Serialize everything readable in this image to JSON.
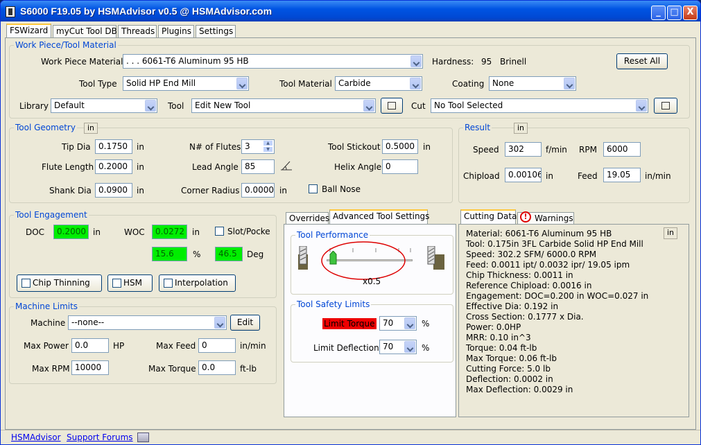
{
  "window": {
    "title": "S6000 F19.05 by HSMAdvisor v0.5 @ HSMAdvisor.com",
    "minimize": "_",
    "maximize": "□",
    "close": "X"
  },
  "tabs": [
    "FSWizard",
    "myCut Tool DB",
    "Threads",
    "Plugins",
    "Settings"
  ],
  "workpiece": {
    "title": "Work Piece/Tool Material",
    "material_label": "Work Piece Material",
    "material_value": ". . . 6061-T6 Aluminum 95 HB",
    "hardness_label": "Hardness:",
    "hardness_value": "95",
    "hardness_unit": "Brinell",
    "reset_label": "Reset All",
    "tooltype_label": "Tool Type",
    "tooltype_value": "Solid HP End Mill",
    "toolmat_label": "Tool Material",
    "toolmat_value": "Carbide",
    "coating_label": "Coating",
    "coating_value": "None",
    "library_label": "Library",
    "library_value": "Default",
    "tool_label": "Tool",
    "tool_value": "Edit New Tool",
    "cut_label": "Cut",
    "cut_value": "No Tool Selected"
  },
  "geometry": {
    "title": "Tool Geometry",
    "unit": "in",
    "tipdia_label": "Tip Dia",
    "tipdia": "0.1750",
    "flutelen_label": "Flute Length",
    "flutelen": "0.2000",
    "shankdia_label": "Shank Dia",
    "shankdia": "0.0900",
    "u": "in",
    "flutes_label": "N# of Flutes",
    "flutes": "3",
    "lead_label": "Lead Angle",
    "lead": "85",
    "corner_label": "Corner Radius",
    "corner": "0.0000",
    "stickout_label": "Tool Stickout",
    "stickout": "0.5000",
    "helix_label": "Helix Angle",
    "helix": "0",
    "ballnose_label": "Ball Nose"
  },
  "result": {
    "title": "Result",
    "unit": "in",
    "speed_label": "Speed",
    "speed": "302",
    "speed_unit": "f/min",
    "rpm_label": "RPM",
    "rpm": "6000",
    "chipload_label": "Chipload",
    "chipload": "0.00106",
    "chipload_unit": "in",
    "feed_label": "Feed",
    "feed": "19.05",
    "feed_unit": "in/min"
  },
  "engagement": {
    "title": "Tool Engagement",
    "doc_label": "DOC",
    "doc": "0.2000",
    "doc_unit": "in",
    "woc_label": "WOC",
    "woc": "0.0272",
    "woc_unit": "in",
    "slot_label": "Slot/Pocke",
    "pct": "15.6",
    "pct_unit": "%",
    "deg": "46.5",
    "deg_unit": "Deg",
    "chip_thinning": "Chip Thinning",
    "hsm": "HSM",
    "interpolation": "Interpolation"
  },
  "machine": {
    "title": "Machine Limits",
    "machine_label": "Machine",
    "machine_value": "--none--",
    "edit_label": "Edit",
    "maxpower_label": "Max Power",
    "maxpower": "0.0",
    "maxpower_unit": "HP",
    "maxfeed_label": "Max Feed",
    "maxfeed": "0",
    "maxfeed_unit": "in/min",
    "maxrpm_label": "Max RPM",
    "maxrpm": "10000",
    "maxtorque_label": "Max Torque",
    "maxtorque": "0.0",
    "maxtorque_unit": "ft-lb"
  },
  "advanced": {
    "tab_overrides": "Overrides",
    "tab_advanced": "Advanced Tool Settings",
    "perf_title": "Tool Performance",
    "perf_value": "x0.5",
    "perf_level": 0.0,
    "safety_title": "Tool Safety Limits",
    "torque_label": "Limit Torque",
    "torque_value": "70",
    "torque_unit": "%",
    "deflection_label": "Limit Deflection",
    "deflection_value": "70",
    "deflection_unit": "%"
  },
  "cutting": {
    "tab_cutting": "Cutting Data",
    "tab_warnings": "Warnings",
    "unit": "in",
    "lines": [
      "Material: 6061-T6 Aluminum 95 HB",
      "Tool: 0.175in 3FL Carbide  Solid HP End Mill",
      "Speed: 302.2 SFM/ 6000.0 RPM",
      "Feed: 0.0011 ipt/ 0.0032 ipr/ 19.05 ipm",
      "Chip Thickness: 0.0011 in",
      "Reference Chipload: 0.0016 in",
      "Engagement:  DOC=0.200 in   WOC=0.027 in",
      "Effective Dia: 0.192 in",
      "Cross Section: 0.1777 x Dia.",
      "Power: 0.0HP",
      "MRR: 0.10 in^3",
      "Torque: 0.04 ft-lb",
      "Max Torque: 0.06 ft-lb",
      "Cutting Force: 5.0 lb",
      "Deflection: 0.0002 in",
      "Max Deflection: 0.0029 in"
    ]
  },
  "footer": {
    "link1": "HSMAdvisor",
    "link2": "Support Forums"
  }
}
